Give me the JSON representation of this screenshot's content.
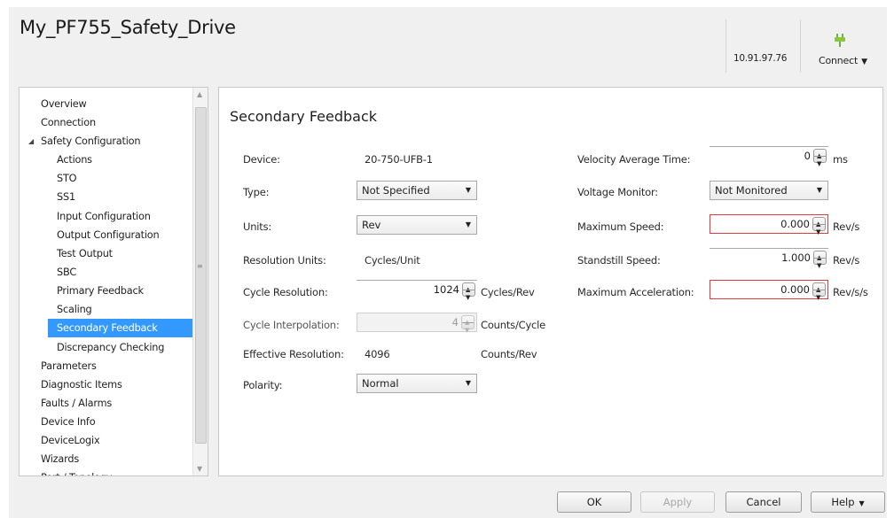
{
  "app": {
    "title": "My_PF755_Safety_Drive",
    "ip_address": "10.91.97.76",
    "connect_label": "Connect"
  },
  "tree": {
    "items": [
      {
        "label": "Overview"
      },
      {
        "label": "Connection"
      },
      {
        "label": "Safety Configuration"
      },
      {
        "label": "Actions"
      },
      {
        "label": "STO"
      },
      {
        "label": "SS1"
      },
      {
        "label": "Input Configuration"
      },
      {
        "label": "Output Configuration"
      },
      {
        "label": "Test Output"
      },
      {
        "label": "SBC"
      },
      {
        "label": "Primary Feedback"
      },
      {
        "label": "Scaling"
      },
      {
        "label": "Secondary Feedback"
      },
      {
        "label": "Discrepancy Checking"
      },
      {
        "label": "Parameters"
      },
      {
        "label": "Diagnostic Items"
      },
      {
        "label": "Faults / Alarms"
      },
      {
        "label": "Device Info"
      },
      {
        "label": "DeviceLogix"
      },
      {
        "label": "Wizards"
      },
      {
        "label": "Port / Topology"
      }
    ],
    "selected": "Secondary Feedback"
  },
  "panel": {
    "title": "Secondary Feedback",
    "left": {
      "device_label": "Device:",
      "device_value": "20-750-UFB-1",
      "type_label": "Type:",
      "type_value": "Not Specified",
      "units_label": "Units:",
      "units_value": "Rev",
      "resolution_units_label": "Resolution Units:",
      "resolution_units_value": "Cycles/Unit",
      "cycle_resolution_label": "Cycle Resolution:",
      "cycle_resolution_value": "1024",
      "cycle_resolution_unit": "Cycles/Rev",
      "cycle_interpolation_label": "Cycle Interpolation:",
      "cycle_interpolation_value": "4",
      "cycle_interpolation_unit": "Counts/Cycle",
      "effective_resolution_label": "Effective Resolution:",
      "effective_resolution_value": "4096",
      "effective_resolution_unit": "Counts/Rev",
      "polarity_label": "Polarity:",
      "polarity_value": "Normal"
    },
    "right": {
      "velocity_average_time_label": "Velocity Average Time:",
      "velocity_average_time_value": "0",
      "velocity_average_time_unit": "ms",
      "voltage_monitor_label": "Voltage Monitor:",
      "voltage_monitor_value": "Not Monitored",
      "maximum_speed_label": "Maximum Speed:",
      "maximum_speed_value": "0.000",
      "maximum_speed_unit": "Rev/s",
      "standstill_speed_label": "Standstill Speed:",
      "standstill_speed_value": "1.000",
      "standstill_speed_unit": "Rev/s",
      "maximum_acceleration_label": "Maximum Acceleration:",
      "maximum_acceleration_value": "0.000",
      "maximum_acceleration_unit": "Rev/s/s"
    }
  },
  "buttons": {
    "ok": "OK",
    "apply": "Apply",
    "cancel": "Cancel",
    "help": "Help"
  },
  "colors": {
    "selection": "#3399ff",
    "error_border": "#e0393e",
    "background": "#f0f0f0"
  }
}
